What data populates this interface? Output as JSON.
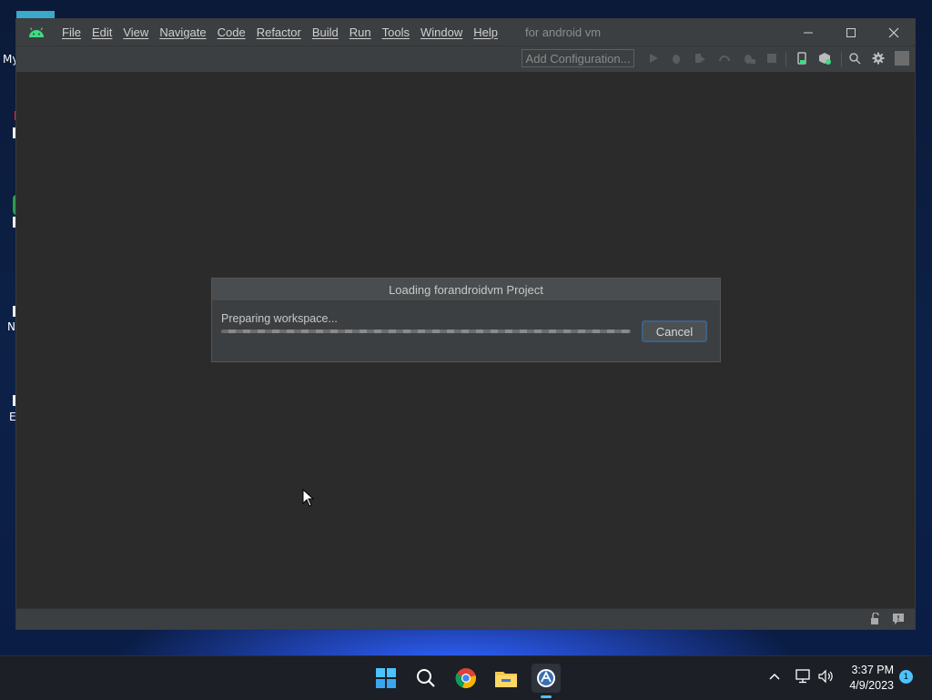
{
  "desktop": {
    "icon_labels": [
      "My",
      "N",
      "E"
    ]
  },
  "ide": {
    "menu": [
      "File",
      "Edit",
      "View",
      "Navigate",
      "Code",
      "Refactor",
      "Build",
      "Run",
      "Tools",
      "Window",
      "Help"
    ],
    "window_title": "for android vm",
    "toolbar": {
      "add_configuration": "Add Configuration..."
    }
  },
  "dialog": {
    "title": "Loading forandroidvm Project",
    "message": "Preparing workspace...",
    "cancel_label": "Cancel",
    "progress": "indeterminate"
  },
  "taskbar": {
    "apps": [
      "start-icon",
      "search-icon",
      "chrome-icon",
      "file-explorer-icon",
      "android-studio-icon"
    ],
    "time": "3:37 PM",
    "date": "4/9/2023",
    "notification_count": "1"
  },
  "colors": {
    "ide_background": "#2b2b2b",
    "ide_chrome": "#3c3f41",
    "android_green": "#3ddc84",
    "taskbar": "#1c1f26"
  }
}
